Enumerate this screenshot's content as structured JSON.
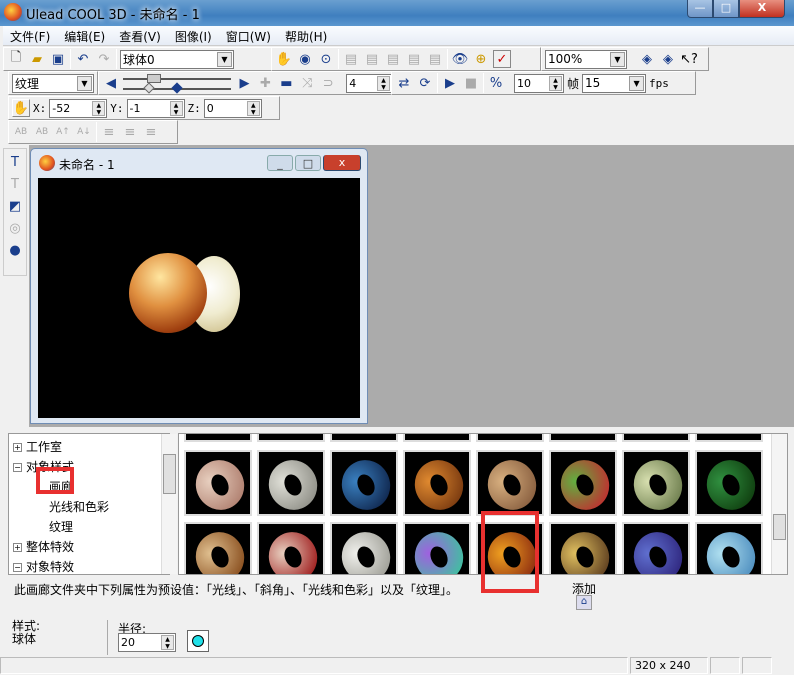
{
  "window": {
    "title": "Ulead COOL 3D - 未命名 - 1",
    "minimize": "—",
    "maximize": "□",
    "close": "X"
  },
  "menu": [
    "文件(F)",
    "编辑(E)",
    "查看(V)",
    "图像(I)",
    "窗口(W)",
    "帮助(H)"
  ],
  "toolbar": {
    "object_select": "球体0",
    "zoom": "100%",
    "attribute_select": "纹理",
    "spin_value": "4",
    "frames": "10",
    "frame_label": "帧",
    "fps_value": "15",
    "fps_label": "fps"
  },
  "position": {
    "x_label": "X:",
    "x": "-52",
    "y_label": "Y:",
    "y": "-1",
    "z_label": "Z:",
    "z": "0"
  },
  "document": {
    "title": "未命名 - 1"
  },
  "tree": {
    "items": [
      {
        "label": "工作室",
        "expander": "+"
      },
      {
        "label": "对象样式",
        "expander": "−"
      },
      {
        "label": "画廊",
        "expander": ""
      },
      {
        "label": "光线和色彩",
        "expander": ""
      },
      {
        "label": "纹理",
        "expander": ""
      },
      {
        "label": "整体特效",
        "expander": "+"
      },
      {
        "label": "对象特效",
        "expander": "−"
      }
    ]
  },
  "gallery": {
    "colors": [
      [
        "#e8d0c0",
        "#b08070"
      ],
      [
        "#e0e0d8",
        "#909088"
      ],
      [
        "#3a80c0",
        "#102850"
      ],
      [
        "#e08a30",
        "#7a3a10"
      ],
      [
        "#d8b080",
        "#8a6040"
      ],
      [
        "#60b040",
        "#c03030"
      ],
      [
        "#d8e0b0",
        "#708050"
      ],
      [
        "#309040",
        "#104010"
      ],
      [
        "#e0c090",
        "#8a5020"
      ],
      [
        "#e8d0c0",
        "#a02020"
      ],
      [
        "#f0f0ec",
        "#a0a098"
      ],
      [
        "#a060e0",
        "#40c0a0"
      ],
      [
        "#f0a020",
        "#903010"
      ],
      [
        "#e0c060",
        "#604020"
      ],
      [
        "#6070d0",
        "#302880"
      ],
      [
        "#b0e0f0",
        "#5090c0"
      ]
    ]
  },
  "description": "此画廊文件夹中下列属性为预设值：「光线」、「斜角」、「光线和色彩」以及「纹理」。",
  "add_label": "添加",
  "properties": {
    "style_label": "样式:",
    "style_value": "球体",
    "radius_label": "半径:",
    "radius_value": "20",
    "color": "#20e0e8"
  },
  "status": {
    "resolution": "320 x 240"
  },
  "highlight_color": "#e8302f"
}
